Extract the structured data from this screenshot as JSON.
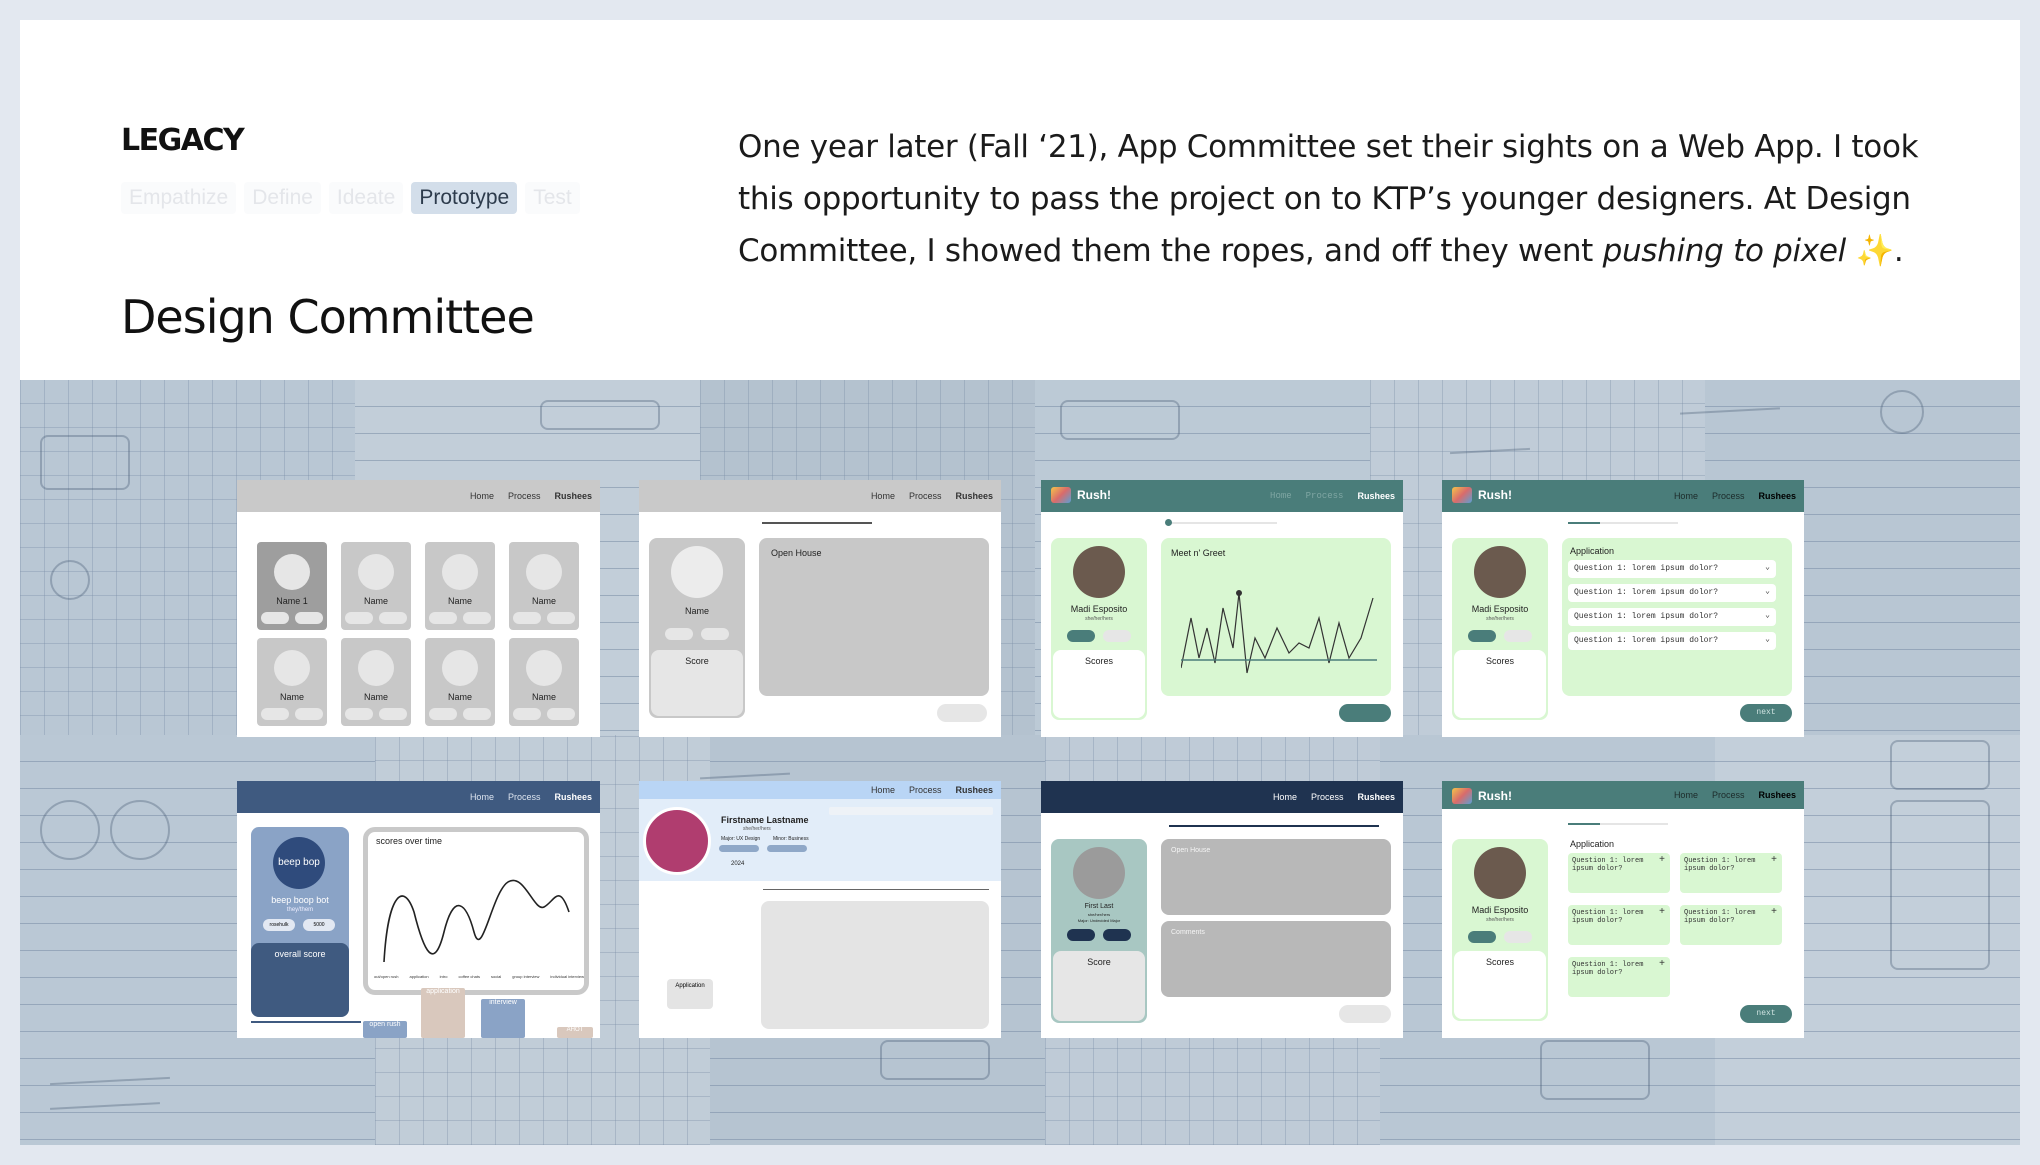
{
  "header": {
    "eyebrow": "LEGACY",
    "steps": [
      "Empathize",
      "Define",
      "Ideate",
      "Prototype",
      "Test"
    ],
    "active_step": "Prototype",
    "title": "Design Committee",
    "paragraph_plain": "One year later (Fall ‘21), App Committee set their sights on a Web App. I took this opportunity to pass the project on to KTP’s younger designers. At Design Committee, I showed them the ropes, and off they went ",
    "paragraph_emphasis": "pushing to pixel",
    "paragraph_end": " ✨."
  },
  "nav": {
    "home": "Home",
    "process": "Process",
    "rushees": "Rushees",
    "brand": "Rush!"
  },
  "shots": {
    "s1": {
      "first_name": "Name 1",
      "name": "Name"
    },
    "s2": {
      "name": "Name",
      "score": "Score",
      "open_house": "Open House"
    },
    "s3": {
      "person": "Madi Esposito",
      "pronouns": "she/her/hers",
      "scores": "Scores",
      "panel_title": "Meet n' Greet"
    },
    "s4": {
      "person": "Madi Esposito",
      "pronouns": "she/her/hers",
      "scores": "Scores",
      "panel_title": "Application",
      "question": "Question 1: lorem ipsum dolor?",
      "next": "next"
    },
    "s5": {
      "badge": "beep bop",
      "person": "beep boop bot",
      "pronouns": "they/them",
      "tag1": "rosehulk",
      "tag2": "5000",
      "overall": "overall score",
      "chart_title": "scores over time",
      "ticks": [
        "out/open rush",
        "application",
        "intro",
        "coffee chats",
        "social",
        "group interview",
        "individual interview"
      ],
      "tab_open": "open rush",
      "tab_app": "application",
      "tab_interview": "interview",
      "tab_ahot": "AHOT"
    },
    "s6": {
      "person": "Firstname Lastname",
      "pronouns": "she/her/hers",
      "major": "Major: UX Design",
      "minor": "Minor: Business",
      "year": "2024",
      "application": "Application"
    },
    "s7": {
      "person": "First Last",
      "pronouns": "she/her/hers",
      "major": "Major: Undecided Major",
      "score": "Score",
      "open_house": "Open House",
      "comments": "Comments"
    },
    "s8": {
      "person": "Madi Esposito",
      "pronouns": "she/her/hers",
      "scores": "Scores",
      "panel_title": "Application",
      "question": "Question 1: lorem ipsum dolor?",
      "next": "next"
    }
  },
  "colors": {
    "teal": "#4a7d7a",
    "mint": "#d9f7d2",
    "navy": "#24344f",
    "slate": "#3f5a80",
    "gray": "#c7c7c7"
  }
}
